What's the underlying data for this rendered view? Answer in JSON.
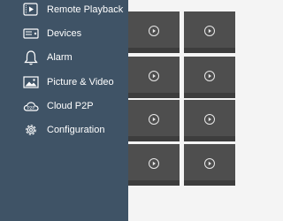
{
  "sidebar": {
    "items": [
      {
        "label": "Remote Playback",
        "icon": "playback-icon"
      },
      {
        "label": "Devices",
        "icon": "devices-icon"
      },
      {
        "label": "Alarm",
        "icon": "bell-icon"
      },
      {
        "label": "Picture & Video",
        "icon": "picture-icon"
      },
      {
        "label": "Cloud P2P",
        "icon": "cloud-icon"
      },
      {
        "label": "Configuration",
        "icon": "gear-icon"
      }
    ]
  },
  "grid": {
    "tiles": [
      {
        "icon": "add-camera-icon"
      },
      {
        "icon": "add-camera-icon"
      },
      {
        "icon": "add-camera-icon"
      },
      {
        "icon": "add-camera-icon"
      },
      {
        "icon": "add-camera-icon"
      },
      {
        "icon": "add-camera-icon"
      },
      {
        "icon": "add-camera-icon"
      },
      {
        "icon": "add-camera-icon"
      }
    ]
  },
  "colors": {
    "sidebar_bg": "#3f5366",
    "tile_bg": "#4e4e4e",
    "page_bg": "#f4f4f4",
    "text": "#ffffff"
  }
}
